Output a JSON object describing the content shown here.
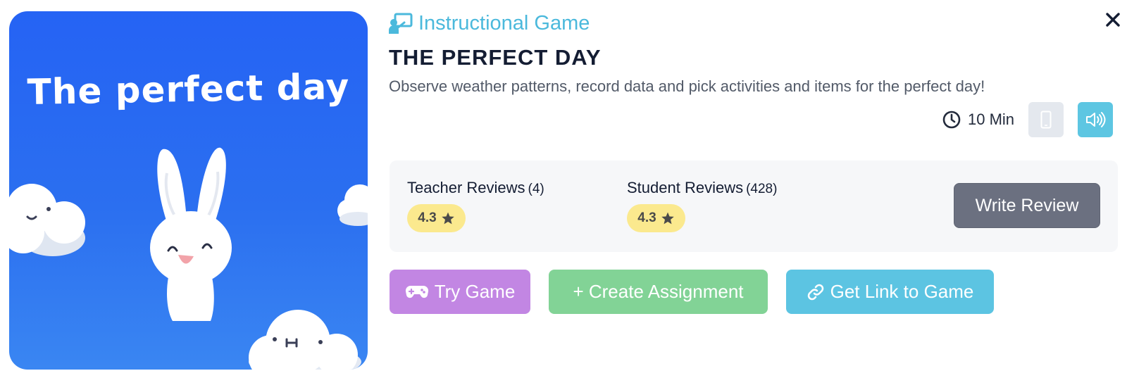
{
  "cover": {
    "title": "The perfect day",
    "background_color": "#2563f4",
    "illustration": [
      "bunny",
      "cloud-left",
      "cloud-bottom",
      "cloud-right"
    ]
  },
  "header": {
    "type_icon": "teacher-board-icon",
    "type_label": "Instructional Game",
    "type_color": "#4bb9dc",
    "title": "THE PERFECT DAY",
    "description": "Observe weather patterns, record data and pick activities and items for the perfect day!",
    "close_icon": "close-icon"
  },
  "meta": {
    "duration_icon": "clock-icon",
    "duration": "10 Min",
    "device_icon": "phone-icon",
    "audio_icon": "speaker-icon"
  },
  "reviews": {
    "teacher": {
      "label": "Teacher Reviews",
      "count": "(4)",
      "rating": "4.3"
    },
    "student": {
      "label": "Student Reviews",
      "count": "(428)",
      "rating": "4.3"
    },
    "star_icon": "star-icon",
    "write_label": "Write Review"
  },
  "actions": {
    "try_game": {
      "label": "Try Game",
      "icon": "gamepad-icon",
      "color": "#c286e3"
    },
    "create_assignment": {
      "label": "+ Create Assignment",
      "color": "#82d396"
    },
    "get_link": {
      "label": "Get Link to Game",
      "icon": "link-icon",
      "color": "#5cc4e2"
    }
  }
}
